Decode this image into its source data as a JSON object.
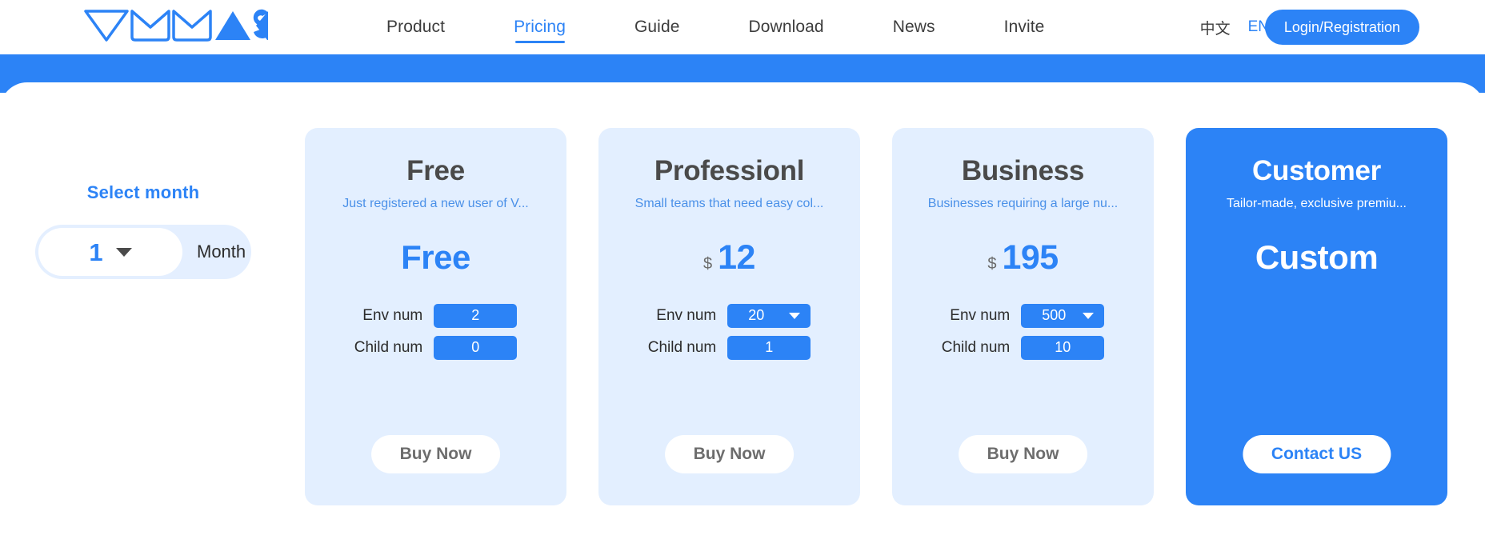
{
  "header": {
    "logo_text": "VMMASK",
    "logo_icon": "vmmask-logo-icon",
    "nav": [
      {
        "label": "Product",
        "active": false
      },
      {
        "label": "Pricing",
        "active": true
      },
      {
        "label": "Guide",
        "active": false
      },
      {
        "label": "Download",
        "active": false
      },
      {
        "label": "News",
        "active": false
      },
      {
        "label": "Invite",
        "active": false
      }
    ],
    "lang_zh": "中文",
    "lang_en": "EN",
    "login_label": "Login/Registration"
  },
  "month_selector": {
    "title": "Select month",
    "value": "1",
    "unit": "Month",
    "caret_icon": "chevron-down-icon"
  },
  "cards": [
    {
      "name": "Free",
      "desc": "Just registered a new user of V...",
      "currency": "",
      "price": "Free",
      "price_is_word": true,
      "specs": [
        {
          "label": "Env num",
          "value": "2",
          "dropdown": false
        },
        {
          "label": "Child num",
          "value": "0",
          "dropdown": false
        }
      ],
      "cta": "Buy Now",
      "featured": false
    },
    {
      "name": "Professionl",
      "desc": "Small teams that need easy col...",
      "currency": "$",
      "price": "12",
      "price_is_word": false,
      "specs": [
        {
          "label": "Env num",
          "value": "20",
          "dropdown": true
        },
        {
          "label": "Child num",
          "value": "1",
          "dropdown": false
        }
      ],
      "cta": "Buy Now",
      "featured": false
    },
    {
      "name": "Business",
      "desc": "Businesses requiring a large nu...",
      "currency": "$",
      "price": "195",
      "price_is_word": false,
      "specs": [
        {
          "label": "Env num",
          "value": "500",
          "dropdown": true
        },
        {
          "label": "Child num",
          "value": "10",
          "dropdown": false
        }
      ],
      "cta": "Buy Now",
      "featured": false
    },
    {
      "name": "Customer",
      "desc": "Tailor-made, exclusive premiu...",
      "currency": "",
      "price": "Custom",
      "price_is_word": true,
      "specs": [],
      "cta": "Contact US",
      "featured": true
    }
  ],
  "colors": {
    "accent": "#2c83f6",
    "card_bg": "#e3efff",
    "pill_bg": "#e4efff",
    "text_dark": "#4a4a4a",
    "cta_text": "#6d6d6d"
  }
}
